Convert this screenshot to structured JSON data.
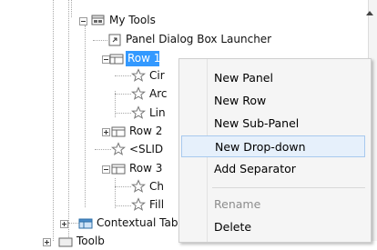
{
  "tree": {
    "nodes": [
      {
        "label": "My Tools"
      },
      {
        "label": "Panel Dialog Box Launcher"
      },
      {
        "label": "Row 1"
      },
      {
        "label": "Cir"
      },
      {
        "label": "Arc"
      },
      {
        "label": "Lin"
      },
      {
        "label": "Row 2"
      },
      {
        "label": "<SLID"
      },
      {
        "label": "Row 3"
      },
      {
        "label": "Ch"
      },
      {
        "label": "Fill"
      },
      {
        "label": "Contextual Tab"
      },
      {
        "label": "Toolb"
      }
    ]
  },
  "menu": {
    "items": [
      {
        "label": "New Panel"
      },
      {
        "label": "New Row"
      },
      {
        "label": "New Sub-Panel"
      },
      {
        "label": "New Drop-down"
      },
      {
        "label": "Add Separator"
      },
      {
        "label": "Rename"
      },
      {
        "label": "Delete"
      }
    ]
  },
  "colors": {
    "selection": "#3399ff",
    "menu_bg": "#f5f5f5",
    "menu_hover_bg": "#e6f0fb",
    "menu_hover_border": "#a8c9ee",
    "disabled_text": "#8d8d8d"
  }
}
